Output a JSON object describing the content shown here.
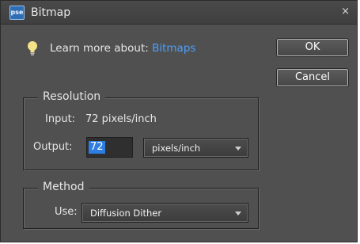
{
  "window": {
    "title": "Bitmap",
    "app_badge": "pse",
    "close_glyph": "×"
  },
  "info": {
    "prefix": "Learn more about:",
    "link": "Bitmaps",
    "icon": "lightbulb-icon"
  },
  "buttons": {
    "ok": "OK",
    "cancel": "Cancel"
  },
  "resolution": {
    "legend": "Resolution",
    "input_label": "Input:",
    "input_value": "72 pixels/inch",
    "output_label": "Output:",
    "output_value": "72",
    "units_selected": "pixels/inch"
  },
  "method": {
    "legend": "Method",
    "use_label": "Use:",
    "selected": "Diffusion Dither"
  },
  "colors": {
    "dialog_bg": "#505050",
    "link": "#4aa0ff",
    "selection": "#2e7de0"
  }
}
